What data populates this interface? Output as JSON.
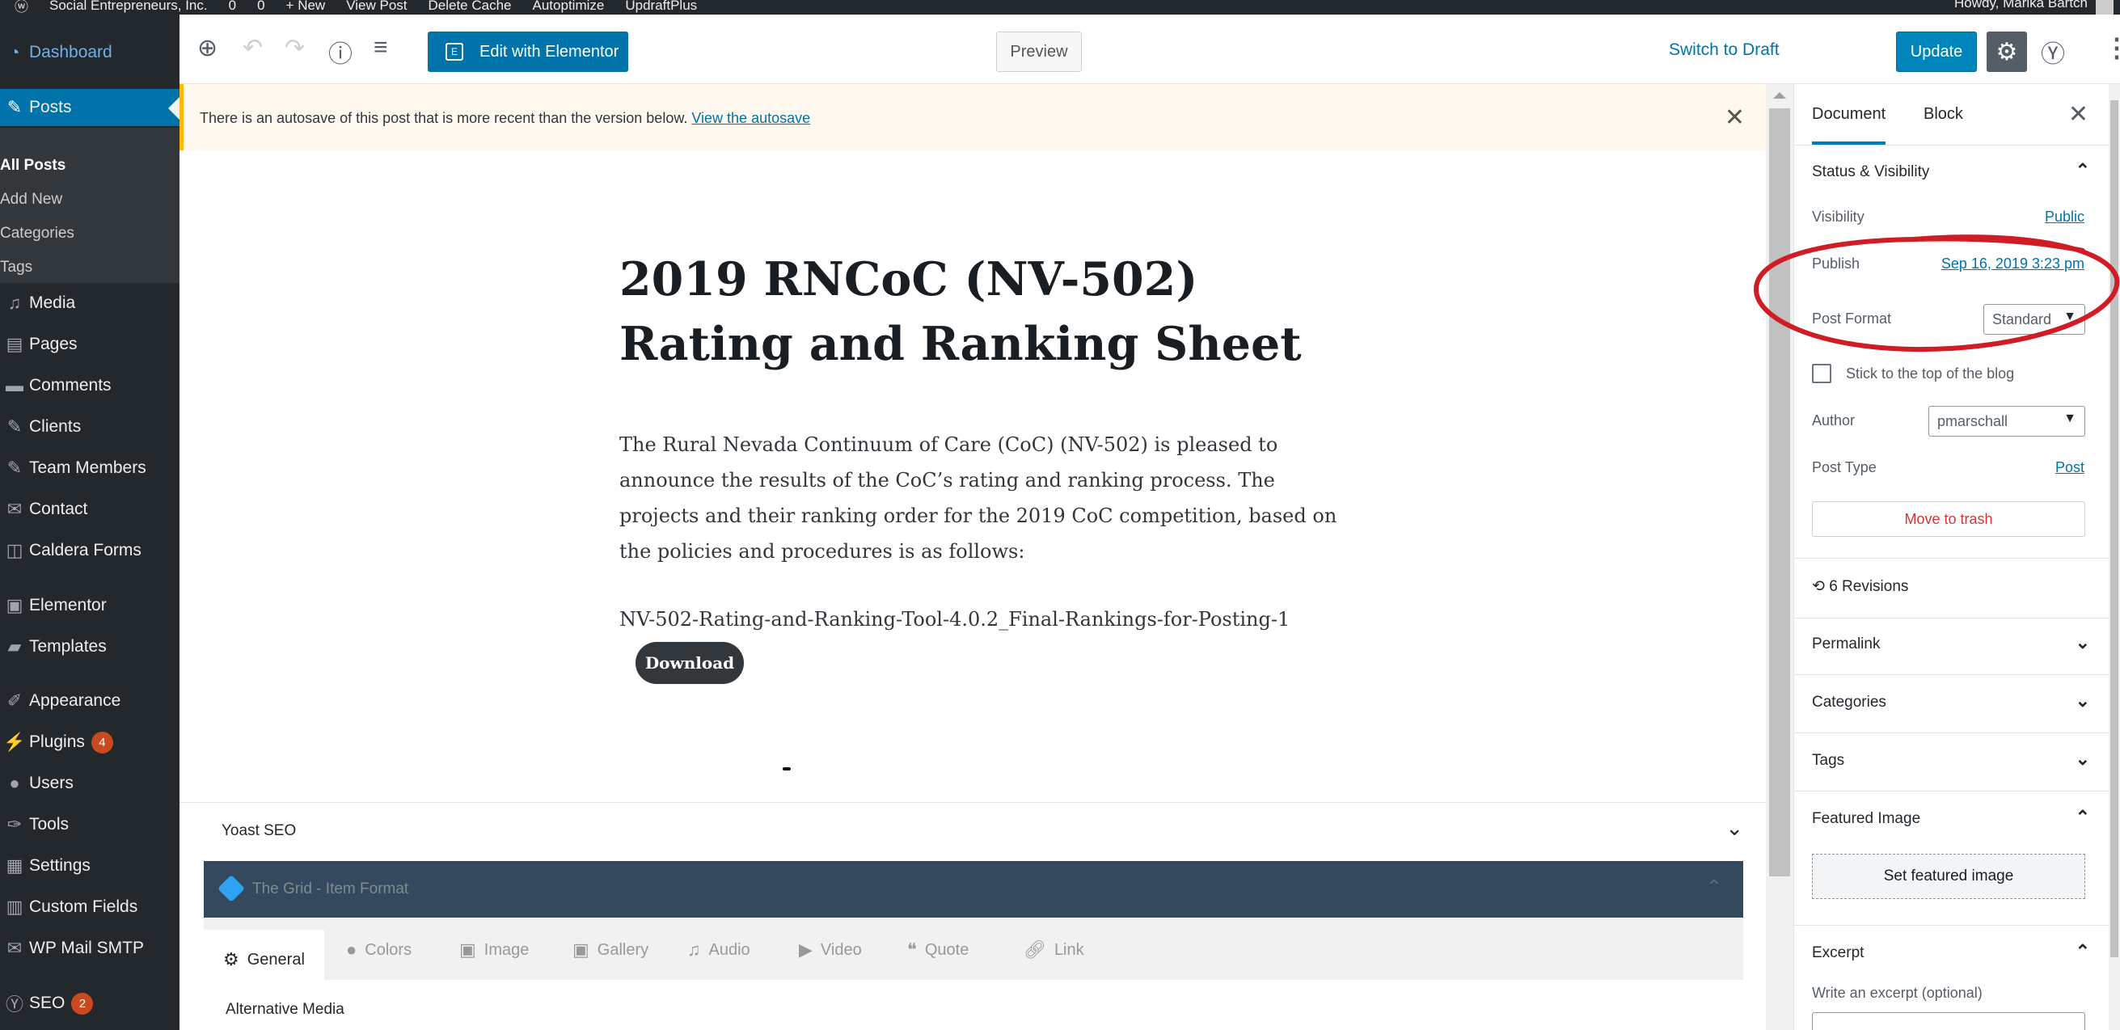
{
  "admin_bar": {
    "items": [
      "Social Entrepreneurs, Inc.",
      "0",
      "0",
      "+ New",
      "View Post",
      "Delete Cache",
      "Autoptimize",
      "UpdraftPlus"
    ],
    "greeting": "Howdy, Marika Bartch"
  },
  "sidebar": {
    "dashboard": "Dashboard",
    "posts": "Posts",
    "submenu": [
      "All Posts",
      "Add New",
      "Categories",
      "Tags"
    ],
    "items": [
      "Media",
      "Pages",
      "Comments",
      "Clients",
      "Team Members",
      "Contact",
      "Caldera Forms",
      "Elementor",
      "Templates",
      "Appearance",
      "Plugins",
      "Users",
      "Tools",
      "Settings",
      "Custom Fields",
      "WP Mail SMTP",
      "SEO"
    ],
    "plugins_badge": "4",
    "seo_badge": "2"
  },
  "toolbar": {
    "edit_elementor": "Edit with Elementor",
    "switch_draft": "Switch to Draft",
    "preview": "Preview",
    "update": "Update"
  },
  "notice": {
    "text": "There is an autosave of this post that is more recent than the version below.",
    "link": "View the autosave"
  },
  "post": {
    "title": "2019 RNCoC (NV-502) Rating and Ranking Sheet",
    "body": "The Rural Nevada Continuum of Care (CoC) (NV-502) is pleased to announce the results of the CoC’s rating and ranking process. The projects and their ranking order for the 2019 CoC competition, based on the policies and procedures is as follows:",
    "file_name": "NV-502-Rating-and-Ranking-Tool-4.0.2_Final-Rankings-for-Posting-1",
    "download": "Download"
  },
  "meta": {
    "yoast": "Yoast SEO",
    "grid": "The Grid - Item Format",
    "tabs": [
      "General",
      "Colors",
      "Image",
      "Gallery",
      "Audio",
      "Video",
      "Quote",
      "Link"
    ],
    "alternative_media": "Alternative Media"
  },
  "settings": {
    "tab_document": "Document",
    "tab_block": "Block",
    "status_visibility": "Status & Visibility",
    "visibility_label": "Visibility",
    "visibility_value": "Public",
    "publish_label": "Publish",
    "publish_value": "Sep 16, 2019 3:23 pm",
    "post_format_label": "Post Format",
    "post_format_value": "Standard",
    "sticky": "Stick to the top of the blog",
    "author_label": "Author",
    "author_value": "pmarschall",
    "post_type_label": "Post Type",
    "post_type_value": "Post",
    "trash": "Move to trash",
    "revisions": "6 Revisions",
    "permalink": "Permalink",
    "categories": "Categories",
    "tags": "Tags",
    "featured_image": "Featured Image",
    "set_featured": "Set featured image",
    "excerpt": "Excerpt",
    "excerpt_hint": "Write an excerpt (optional)"
  },
  "colors": {
    "admin_dark": "#23282d",
    "wp_blue": "#0073aa",
    "annotation_red": "#d01c24"
  }
}
